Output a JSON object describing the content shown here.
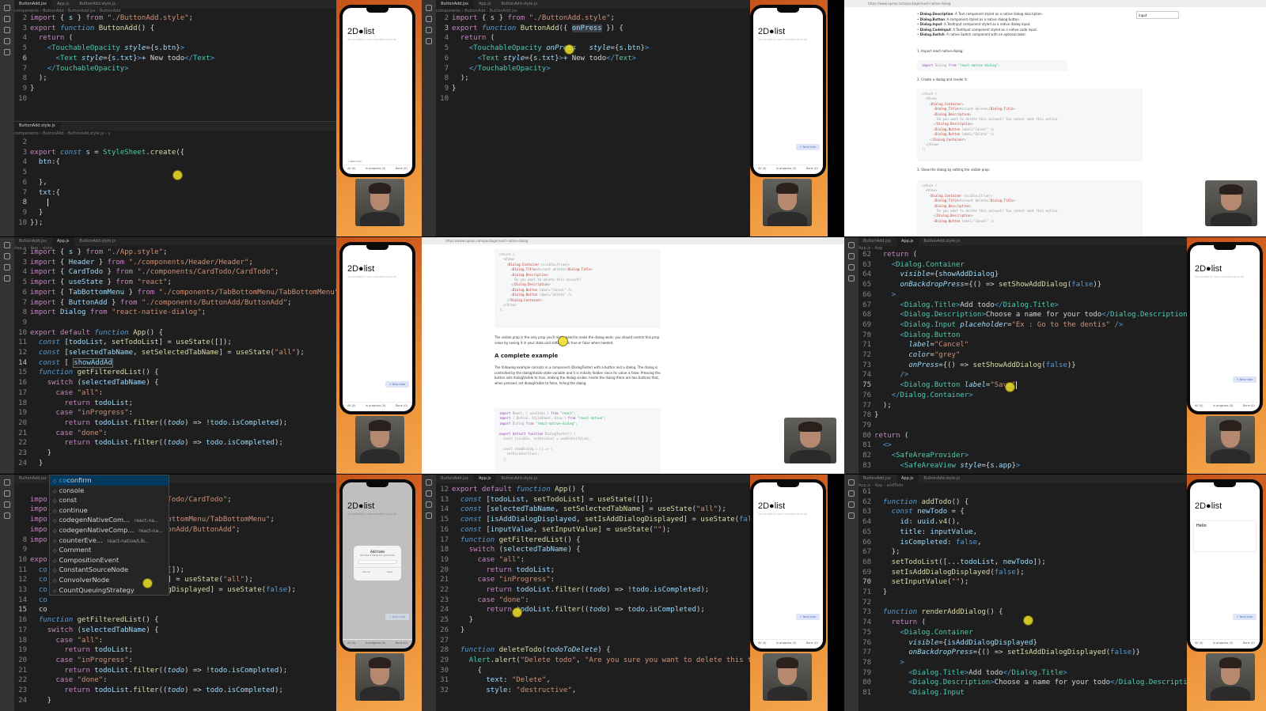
{
  "tabs": {
    "button_add": "ButtonAdd.jsx",
    "app": "App.js",
    "button_add_style": "ButtonAdd.style.js"
  },
  "phone_app": {
    "title": "2D●list",
    "subtitle": "You probably have something to do",
    "new_todo_button": "+ New todo",
    "menu": [
      "All (0)",
      "In progress (0)",
      "Done (0)"
    ],
    "input_value": "Hello",
    "dialog_title": "Add todo",
    "dialog_desc": "Choose a name for your todo",
    "dialog_cancel": "Cancel",
    "dialog_save": "Save"
  },
  "web": {
    "url": "https://www.npmjs.com/package/react-native-dialog",
    "item1_label": "Dialog.Description",
    "item1_text": ": A Text component styled as a native dialog description.",
    "item2_label": "Dialog.Button",
    "item2_text": ": A component styled as a native dialog button.",
    "item3_label": "Dialog.Input",
    "item3_text": ": A TextInput component styled as a native dialog input.",
    "item4_label": "Dialog.CodeInput",
    "item4_text": ": A TextInput component styled as a native code input.",
    "item5_label": "Dialog.Switch",
    "item5_text": ": A native Switch component with an optional label.",
    "step1": "1. Import react-native-dialog:",
    "step2": "2. Create a dialog and render it:",
    "step3": "3. Show the dialog by setting the visible prop:",
    "visible_para": "The visible prop is the only prop you'll really need to make the dialog work: you should control this prop value by saving it in your state and setting it to true or false when needed.",
    "heading": "A complete example",
    "example_para": "The following example consists in a component (DialogTester) with a button and a dialog. The dialog is controlled by the dialogVisible state variable and it is initially hidden since its value is false. Pressing the button sets dialogVisible to true, making the dialog visible. Inside the dialog there are two buttons that, when pressed, set dialogVisible to false, hiding the dialog.",
    "find_text": "input"
  },
  "autocomplete": [
    {
      "text": "confirm",
      "hint": ""
    },
    {
      "text": "console",
      "hint": ""
    },
    {
      "text": "const",
      "hint": ""
    },
    {
      "text": "continue",
      "hint": ""
    },
    {
      "text": "codegenNativeCom...",
      "hint": "react-na..."
    },
    {
      "text": "codegenNativeComp...",
      "hint": "react-na..."
    },
    {
      "text": "counterEve...",
      "hint": "react-native/Lib..."
    },
    {
      "text": "Comment",
      "hint": ""
    },
    {
      "text": "CompositionEvent",
      "hint": ""
    },
    {
      "text": "ConstantSourceNode",
      "hint": ""
    },
    {
      "text": "ConvolverNode",
      "hint": ""
    },
    {
      "text": "CountQueuingStrategy",
      "hint": ""
    }
  ]
}
